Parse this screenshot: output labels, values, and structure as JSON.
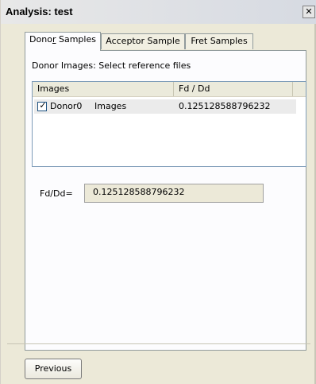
{
  "window": {
    "title": "Analysis: test",
    "close_glyph": "✕"
  },
  "tabs": [
    {
      "label": "Donor Samples",
      "active": true,
      "mnemonic_prefix": "Dono",
      "mnemonic": "r",
      "mnemonic_suffix": " Samples"
    },
    {
      "label": "Acceptor Sample",
      "active": false
    },
    {
      "label": "Fret Samples",
      "active": false
    }
  ],
  "panel": {
    "instruction": "Donor Images: Select reference files",
    "list": {
      "columns": [
        "Images",
        "Fd / Dd"
      ],
      "rows": [
        {
          "checked": true,
          "name": "Donor0",
          "images": "Images",
          "value": "0.125128588796232"
        }
      ]
    },
    "result": {
      "label": "Fd/Dd=",
      "value": "0.125128588796232"
    }
  },
  "footer": {
    "previous_label": "Previous"
  },
  "icons": {
    "close": "close-icon",
    "check": "checkmark-icon"
  },
  "colors": {
    "window_bg": "#ece9d8",
    "panel_bg": "#fcfcfe",
    "border": "#919b9c",
    "list_border": "#7f9db9"
  }
}
